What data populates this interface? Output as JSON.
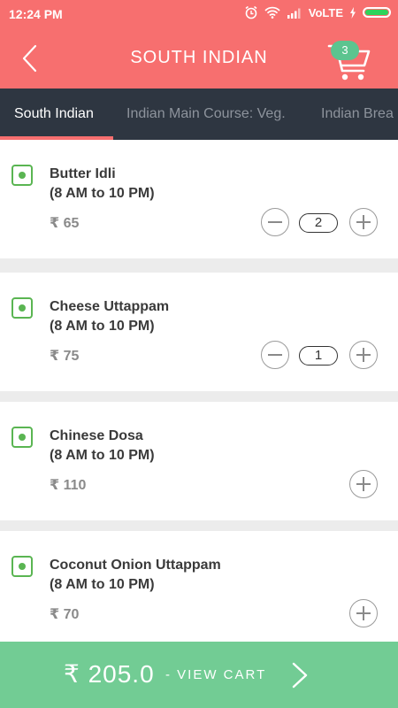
{
  "status_bar": {
    "time": "12:24 PM",
    "network": "VoLTE"
  },
  "app_bar": {
    "title": "SOUTH INDIAN",
    "cart_count": "3"
  },
  "tabs": [
    {
      "label": "South Indian",
      "active": true
    },
    {
      "label": "Indian Main Course: Veg."
    },
    {
      "label": "Indian Brea"
    }
  ],
  "items": [
    {
      "name": "Butter Idli",
      "hours": "(8 AM to 10 PM)",
      "price": "₹ 65",
      "qty": "2"
    },
    {
      "name": "Cheese Uttappam",
      "hours": "(8 AM to 10 PM)",
      "price": "₹ 75",
      "qty": "1"
    },
    {
      "name": "Chinese Dosa",
      "hours": "(8 AM to 10 PM)",
      "price": "₹ 110"
    },
    {
      "name": "Coconut Onion Uttappam",
      "hours": "(8 AM to 10 PM)",
      "price": "₹ 70"
    }
  ],
  "footer": {
    "total": "₹ 205.0",
    "cta": "- VIEW CART"
  },
  "colors": {
    "header": "#f76f6f",
    "tabs_bg": "#2e3641",
    "veg": "#5ab552",
    "footer": "#72cc94",
    "badge": "#5cc48f"
  },
  "icons": {
    "back": "chevron-left-icon",
    "cart": "cart-icon",
    "veg": "veg-mark-icon",
    "minus": "minus-circle-icon",
    "plus": "plus-circle-icon",
    "next": "chevron-right-icon"
  }
}
